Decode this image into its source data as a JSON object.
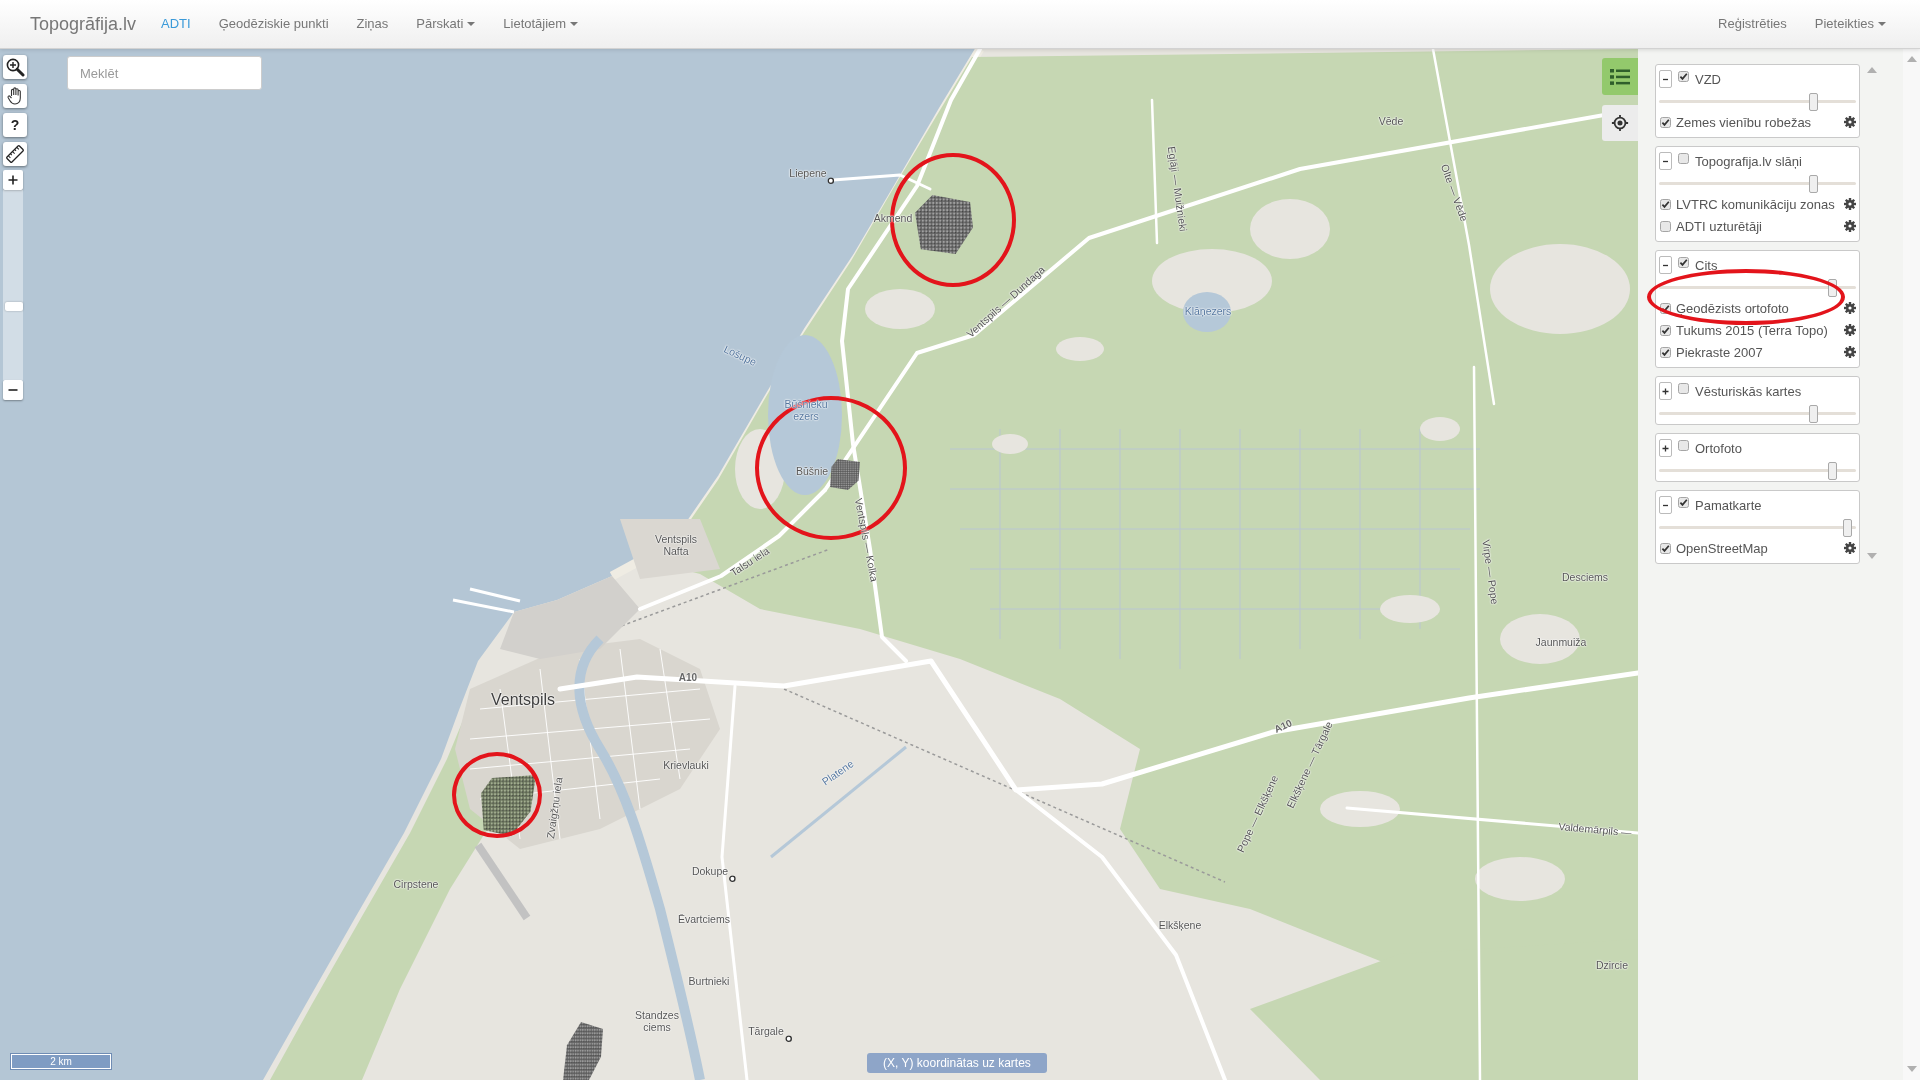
{
  "navbar": {
    "brand": "Topogrāfija.lv",
    "items": [
      {
        "label": "ADTI",
        "selected": true,
        "dropdown": false
      },
      {
        "label": "Ģeodēziskie punkti",
        "selected": false,
        "dropdown": false
      },
      {
        "label": "Ziņas",
        "selected": false,
        "dropdown": false
      },
      {
        "label": "Pārskati",
        "selected": false,
        "dropdown": true
      },
      {
        "label": "Lietotājiem",
        "selected": false,
        "dropdown": true
      }
    ],
    "right_items": [
      {
        "label": "Reģistrēties",
        "dropdown": false
      },
      {
        "label": "Pieteikties",
        "dropdown": true
      }
    ]
  },
  "map": {
    "search": {
      "placeholder": "Meklēt"
    },
    "tools": [
      {
        "kind": "zoom-box"
      },
      {
        "kind": "pan"
      },
      {
        "kind": "help",
        "label": "?"
      },
      {
        "kind": "measure"
      }
    ],
    "zoom_slider": {
      "level": 0.38
    },
    "layers_button": {
      "selected": true
    },
    "labels": [
      {
        "text": "Liepene",
        "kind": "village"
      },
      {
        "text": "Akmend",
        "kind": "place"
      },
      {
        "text": "Vēde",
        "kind": "place"
      },
      {
        "text": "Egļāji — Muižnieki",
        "kind": "road"
      },
      {
        "text": "Olte — Vēde",
        "kind": "road"
      },
      {
        "text": "Klāņezers",
        "kind": "water"
      },
      {
        "text": "Lošupe",
        "kind": "water"
      },
      {
        "text": "Būšnieku ezers",
        "kind": "water"
      },
      {
        "text": "Būšnie",
        "kind": "place"
      },
      {
        "text": "Ventspils — Dundaga",
        "kind": "road"
      },
      {
        "text": "Ventspils — Kolka",
        "kind": "road"
      },
      {
        "text": "Ventspils Nafta",
        "kind": "place"
      },
      {
        "text": "Talsu iela",
        "kind": "road"
      },
      {
        "text": "A10",
        "kind": "ref"
      },
      {
        "text": "Ventspils",
        "kind": "town"
      },
      {
        "text": "Krievlauki",
        "kind": "place"
      },
      {
        "text": "Platene",
        "kind": "water"
      },
      {
        "text": "A10",
        "kind": "ref"
      },
      {
        "text": "Elkšķene — Tārgale",
        "kind": "road"
      },
      {
        "text": "Pope — Elkšķene",
        "kind": "road"
      },
      {
        "text": "Zvaigžņu iela",
        "kind": "road"
      },
      {
        "text": "Cirpstene",
        "kind": "place"
      },
      {
        "text": "Dokupe",
        "kind": "village"
      },
      {
        "text": "Ēvartciems",
        "kind": "place"
      },
      {
        "text": "Burtnieki",
        "kind": "place"
      },
      {
        "text": "Standzes ciems",
        "kind": "place"
      },
      {
        "text": "Tārgale",
        "kind": "village"
      },
      {
        "text": "Elkšķene",
        "kind": "place"
      },
      {
        "text": "Desciems",
        "kind": "place"
      },
      {
        "text": "Jaunmuiža",
        "kind": "place"
      },
      {
        "text": "Virpe — Pope",
        "kind": "road"
      },
      {
        "text": "Valdemārpils —",
        "kind": "road"
      },
      {
        "text": "Dzircie",
        "kind": "place"
      }
    ],
    "scale": "2 km",
    "coordinates": "(X, Y) koordinātas uz kartes"
  },
  "layer_groups": [
    {
      "title": "VZD",
      "expanded": true,
      "checked": true,
      "level": 0.8,
      "layers": [
        {
          "name": "Zemes vienību robežas",
          "checked": true
        }
      ]
    },
    {
      "title": "Topografija.lv slāņi",
      "expanded": true,
      "checked": false,
      "level": 0.8,
      "layers": [
        {
          "name": "LVTRC komunikāciju zonas",
          "checked": true
        },
        {
          "name": "ADTI uzturētāji",
          "checked": false
        }
      ]
    },
    {
      "title": "Cits",
      "expanded": true,
      "checked": true,
      "level": 0.9,
      "layers": [
        {
          "name": "Ģeodēzists ortofoto",
          "checked": true
        },
        {
          "name": "Tukums 2015 (Terra Topo)",
          "checked": true
        },
        {
          "name": "Piekraste 2007",
          "checked": true
        }
      ]
    },
    {
      "title": "Vēsturiskās kartes",
      "expanded": false,
      "checked": false,
      "level": 0.8
    },
    {
      "title": "Ortofoto",
      "expanded": false,
      "checked": false,
      "level": 0.9
    },
    {
      "title": "Pamatkarte",
      "expanded": true,
      "checked": true,
      "level": 0.98,
      "layers": [
        {
          "name": "OpenStreetMap",
          "checked": true
        }
      ]
    }
  ]
}
